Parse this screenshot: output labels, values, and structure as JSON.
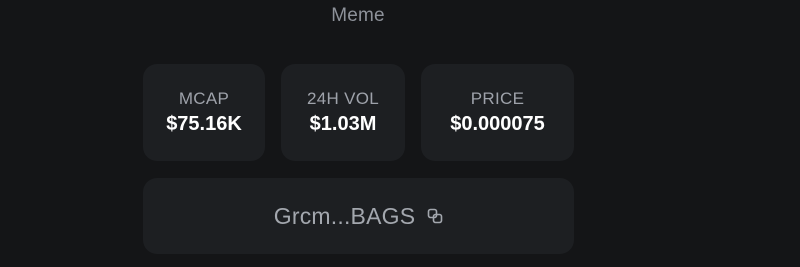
{
  "token": {
    "category": "Meme"
  },
  "stats": [
    {
      "label": "MCAP",
      "value": "$75.16K"
    },
    {
      "label": "24H VOL",
      "value": "$1.03M"
    },
    {
      "label": "PRICE",
      "value": "$0.000075"
    }
  ],
  "address": {
    "short": "Grcm...BAGS",
    "icon": "copy-icon"
  },
  "colors": {
    "background": "#141517",
    "card": "#1d1f22",
    "label": "#9ea2aa",
    "value": "#ffffff"
  }
}
